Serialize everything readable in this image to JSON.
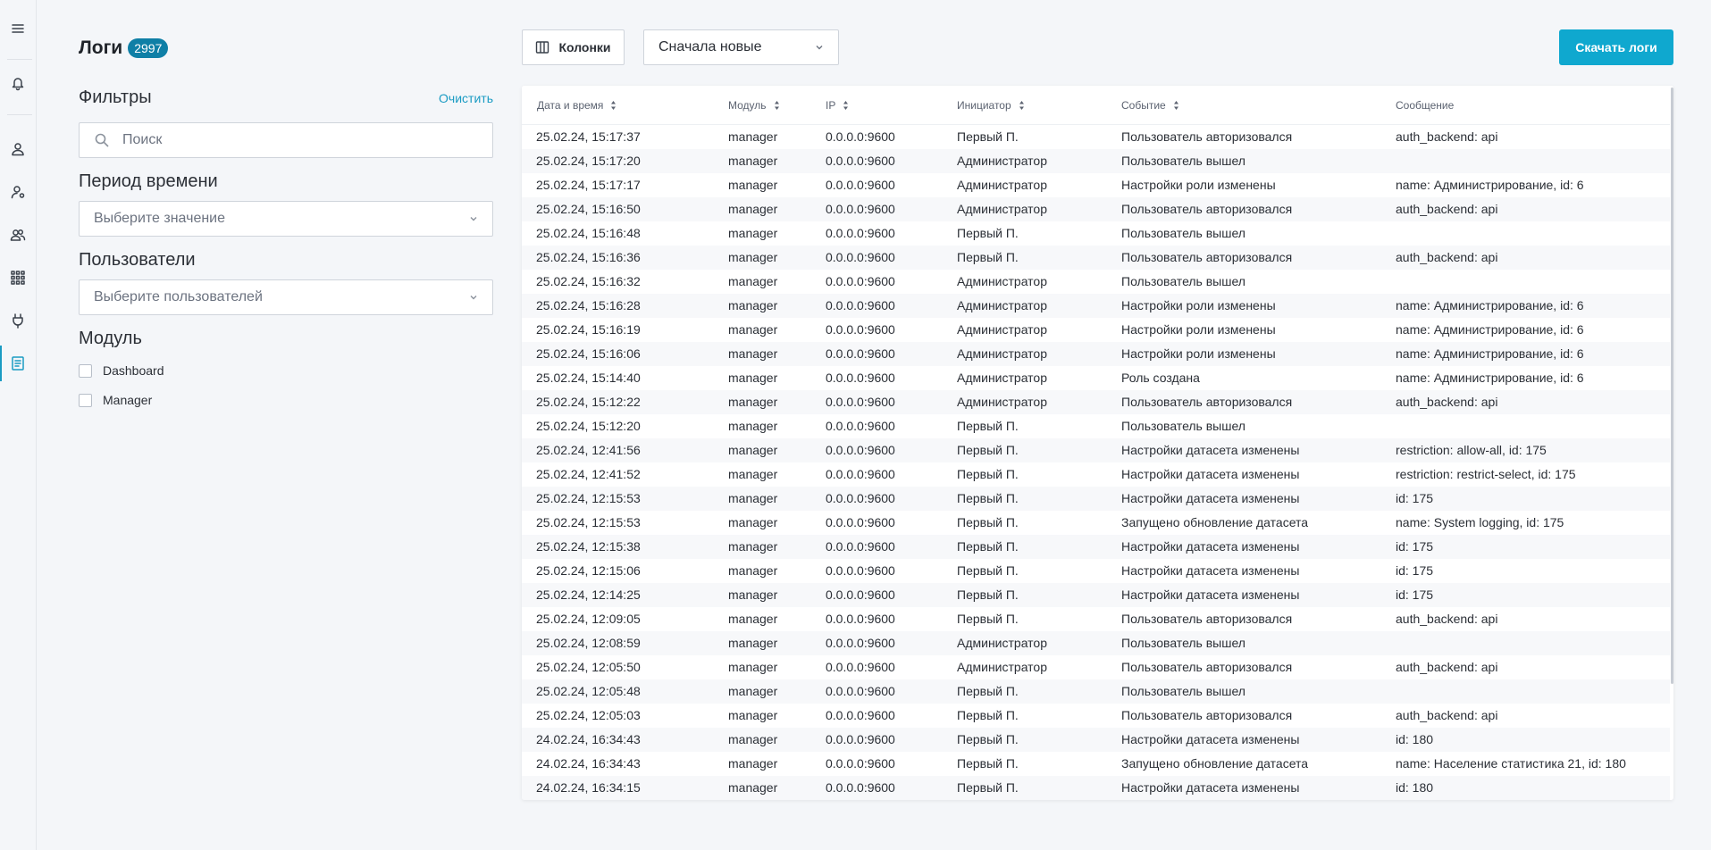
{
  "nav": {
    "icons": [
      "menu-icon",
      "bell-icon",
      "user-icon",
      "user-settings-icon",
      "users-icon",
      "apps-grid-icon",
      "plug-icon",
      "logs-icon"
    ]
  },
  "header": {
    "title": "Логи",
    "count": "2997"
  },
  "filters": {
    "title": "Фильтры",
    "clear_label": "Очистить",
    "search_placeholder": "Поиск",
    "period_label": "Период времени",
    "period_placeholder": "Выберите значение",
    "users_label": "Пользователи",
    "users_placeholder": "Выберите пользователей",
    "module_label": "Модуль",
    "modules": [
      {
        "label": "Dashboard",
        "checked": false
      },
      {
        "label": "Manager",
        "checked": false
      }
    ]
  },
  "toolbar": {
    "columns_label": "Колонки",
    "sort_value": "Сначала новые",
    "download_label": "Скачать логи"
  },
  "table": {
    "columns": [
      "Дата и время",
      "Модуль",
      "IP",
      "Инициатор",
      "Событие",
      "Сообщение"
    ],
    "rows": [
      [
        "25.02.24, 15:17:37",
        "manager",
        "0.0.0.0:9600",
        "Первый П.",
        "Пользователь авторизовался",
        "auth_backend: api"
      ],
      [
        "25.02.24, 15:17:20",
        "manager",
        "0.0.0.0:9600",
        "Администратор",
        "Пользователь вышел",
        ""
      ],
      [
        "25.02.24, 15:17:17",
        "manager",
        "0.0.0.0:9600",
        "Администратор",
        "Настройки роли изменены",
        "name: Администрирование, id: 6"
      ],
      [
        "25.02.24, 15:16:50",
        "manager",
        "0.0.0.0:9600",
        "Администратор",
        "Пользователь авторизовался",
        "auth_backend: api"
      ],
      [
        "25.02.24, 15:16:48",
        "manager",
        "0.0.0.0:9600",
        "Первый П.",
        "Пользователь вышел",
        ""
      ],
      [
        "25.02.24, 15:16:36",
        "manager",
        "0.0.0.0:9600",
        "Первый П.",
        "Пользователь авторизовался",
        "auth_backend: api"
      ],
      [
        "25.02.24, 15:16:32",
        "manager",
        "0.0.0.0:9600",
        "Администратор",
        "Пользователь вышел",
        ""
      ],
      [
        "25.02.24, 15:16:28",
        "manager",
        "0.0.0.0:9600",
        "Администратор",
        "Настройки роли изменены",
        "name: Администрирование, id: 6"
      ],
      [
        "25.02.24, 15:16:19",
        "manager",
        "0.0.0.0:9600",
        "Администратор",
        "Настройки роли изменены",
        "name: Администрирование, id: 6"
      ],
      [
        "25.02.24, 15:16:06",
        "manager",
        "0.0.0.0:9600",
        "Администратор",
        "Настройки роли изменены",
        "name: Администрирование, id: 6"
      ],
      [
        "25.02.24, 15:14:40",
        "manager",
        "0.0.0.0:9600",
        "Администратор",
        "Роль создана",
        "name: Администрирование, id: 6"
      ],
      [
        "25.02.24, 15:12:22",
        "manager",
        "0.0.0.0:9600",
        "Администратор",
        "Пользователь авторизовался",
        "auth_backend: api"
      ],
      [
        "25.02.24, 15:12:20",
        "manager",
        "0.0.0.0:9600",
        "Первый П.",
        "Пользователь вышел",
        ""
      ],
      [
        "25.02.24, 12:41:56",
        "manager",
        "0.0.0.0:9600",
        "Первый П.",
        "Настройки датасета изменены",
        "restriction: allow-all, id: 175"
      ],
      [
        "25.02.24, 12:41:52",
        "manager",
        "0.0.0.0:9600",
        "Первый П.",
        "Настройки датасета изменены",
        "restriction: restrict-select, id: 175"
      ],
      [
        "25.02.24, 12:15:53",
        "manager",
        "0.0.0.0:9600",
        "Первый П.",
        "Настройки датасета изменены",
        "id: 175"
      ],
      [
        "25.02.24, 12:15:53",
        "manager",
        "0.0.0.0:9600",
        "Первый П.",
        "Запущено обновление датасета",
        "name: System logging, id: 175"
      ],
      [
        "25.02.24, 12:15:38",
        "manager",
        "0.0.0.0:9600",
        "Первый П.",
        "Настройки датасета изменены",
        "id: 175"
      ],
      [
        "25.02.24, 12:15:06",
        "manager",
        "0.0.0.0:9600",
        "Первый П.",
        "Настройки датасета изменены",
        "id: 175"
      ],
      [
        "25.02.24, 12:14:25",
        "manager",
        "0.0.0.0:9600",
        "Первый П.",
        "Настройки датасета изменены",
        "id: 175"
      ],
      [
        "25.02.24, 12:09:05",
        "manager",
        "0.0.0.0:9600",
        "Первый П.",
        "Пользователь авторизовался",
        "auth_backend: api"
      ],
      [
        "25.02.24, 12:08:59",
        "manager",
        "0.0.0.0:9600",
        "Администратор",
        "Пользователь вышел",
        ""
      ],
      [
        "25.02.24, 12:05:50",
        "manager",
        "0.0.0.0:9600",
        "Администратор",
        "Пользователь авторизовался",
        "auth_backend: api"
      ],
      [
        "25.02.24, 12:05:48",
        "manager",
        "0.0.0.0:9600",
        "Первый П.",
        "Пользователь вышел",
        ""
      ],
      [
        "25.02.24, 12:05:03",
        "manager",
        "0.0.0.0:9600",
        "Первый П.",
        "Пользователь авторизовался",
        "auth_backend: api"
      ],
      [
        "24.02.24, 16:34:43",
        "manager",
        "0.0.0.0:9600",
        "Первый П.",
        "Настройки датасета изменены",
        "id: 180"
      ],
      [
        "24.02.24, 16:34:43",
        "manager",
        "0.0.0.0:9600",
        "Первый П.",
        "Запущено обновление датасета",
        "name: Население статистика 21, id: 180"
      ],
      [
        "24.02.24, 16:34:15",
        "manager",
        "0.0.0.0:9600",
        "Первый П.",
        "Настройки датасета изменены",
        "id: 180"
      ]
    ]
  },
  "colors": {
    "accent": "#1a9bc3",
    "primary_button": "#0fa8cf",
    "badge": "#0f7fa6",
    "page_background": "#f4f6f9",
    "row_stripe": "#f7f8fa"
  }
}
